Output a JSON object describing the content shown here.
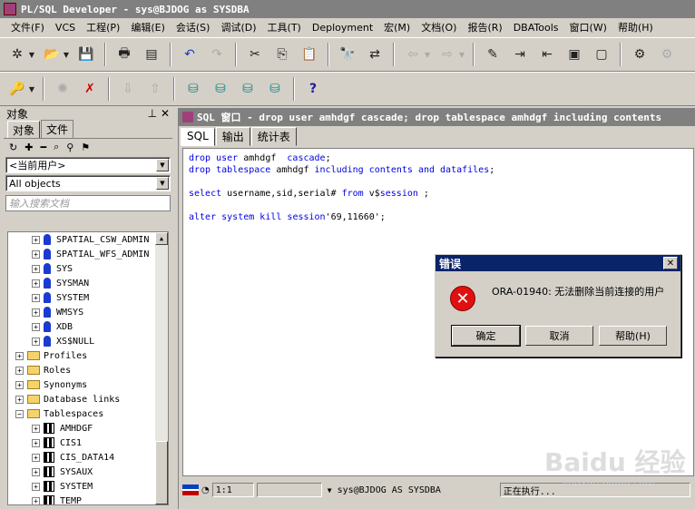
{
  "window": {
    "title": "PL/SQL Developer - sys@BJDOG as SYSDBA"
  },
  "menu": [
    "文件(F)",
    "VCS",
    "工程(P)",
    "编辑(E)",
    "会话(S)",
    "调试(D)",
    "工具(T)",
    "Deployment",
    "宏(M)",
    "文档(O)",
    "报告(R)",
    "DBATools",
    "窗口(W)",
    "帮助(H)"
  ],
  "left_panel": {
    "header": "对象",
    "pin": "⊥",
    "close": "✕",
    "tabs": [
      "对象",
      "文件"
    ],
    "owner_select": "<当前用户>",
    "filter_select": "All objects",
    "search_placeholder": "输入搜索文档",
    "tree": [
      {
        "label": "SPATIAL_CSW_ADMIN",
        "type": "user",
        "indent": 2
      },
      {
        "label": "SPATIAL_WFS_ADMIN",
        "type": "user",
        "indent": 2
      },
      {
        "label": "SYS",
        "type": "user",
        "indent": 2
      },
      {
        "label": "SYSMAN",
        "type": "user",
        "indent": 2
      },
      {
        "label": "SYSTEM",
        "type": "user",
        "indent": 2
      },
      {
        "label": "WMSYS",
        "type": "user",
        "indent": 2
      },
      {
        "label": "XDB",
        "type": "user",
        "indent": 2
      },
      {
        "label": "XS$NULL",
        "type": "user",
        "indent": 2
      },
      {
        "label": "Profiles",
        "type": "folder",
        "indent": 1,
        "exp": "+"
      },
      {
        "label": "Roles",
        "type": "folder",
        "indent": 1,
        "exp": "+"
      },
      {
        "label": "Synonyms",
        "type": "folder",
        "indent": 1,
        "exp": "+"
      },
      {
        "label": "Database links",
        "type": "folder",
        "indent": 1,
        "exp": "+"
      },
      {
        "label": "Tablespaces",
        "type": "folder",
        "indent": 1,
        "exp": "−"
      },
      {
        "label": "AMHDGF",
        "type": "tablespace",
        "indent": 2
      },
      {
        "label": "CIS1",
        "type": "tablespace",
        "indent": 2
      },
      {
        "label": "CIS_DATA14",
        "type": "tablespace",
        "indent": 2
      },
      {
        "label": "SYSAUX",
        "type": "tablespace",
        "indent": 2
      },
      {
        "label": "SYSTEM",
        "type": "tablespace",
        "indent": 2
      },
      {
        "label": "TEMP",
        "type": "tablespace",
        "indent": 2
      }
    ]
  },
  "editor": {
    "title": "SQL 窗口 - drop user amhdgf cascade; drop tablespace amhdgf including contents",
    "tabs": [
      "SQL",
      "输出",
      "统计表"
    ],
    "lines": [
      "drop user amhdgf  cascade;",
      "drop tablespace amhdgf including contents and datafiles;",
      "",
      "select username,sid,serial# from v$session ;",
      "",
      "alter system kill session'69,11660';"
    ]
  },
  "status_bar": {
    "position": "1:1",
    "connection": "sys@BJDOG AS SYSDBA",
    "state": "正在执行..."
  },
  "dialog": {
    "title": "错误",
    "message": "ORA-01940: 无法删除当前连接的用户",
    "buttons": [
      "确定",
      "取消",
      "帮助(H)"
    ]
  },
  "watermark": {
    "brand": "Baidu 经验",
    "url": "jingyan.baidu.com"
  }
}
